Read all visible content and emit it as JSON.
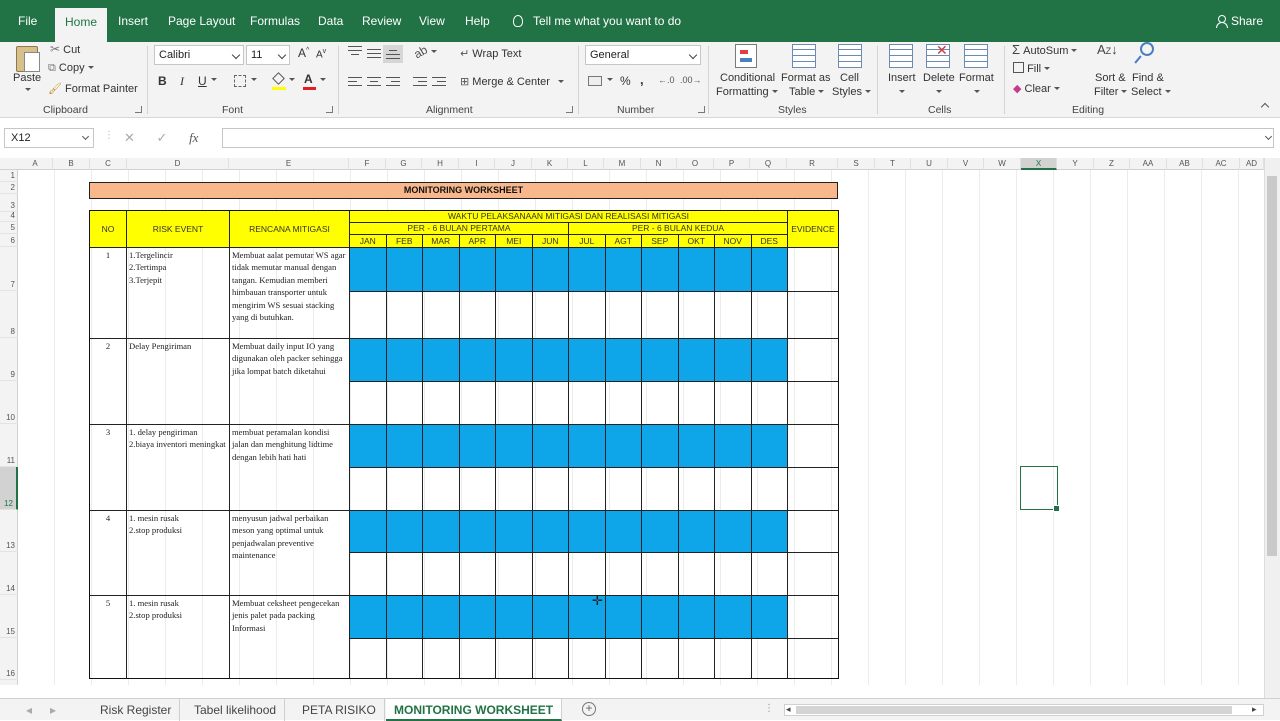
{
  "menu": {
    "tabs": [
      "File",
      "Home",
      "Insert",
      "Page Layout",
      "Formulas",
      "Data",
      "Review",
      "View",
      "Help"
    ],
    "active_tab": "Home",
    "tell_me": "Tell me what you want to do",
    "share": "Share"
  },
  "ribbon": {
    "clipboard": {
      "paste": "Paste",
      "cut": "Cut",
      "copy": "Copy",
      "format_painter": "Format Painter",
      "label": "Clipboard"
    },
    "font": {
      "family": "Calibri",
      "size": "11",
      "bold": "B",
      "italic": "I",
      "underline": "U",
      "label": "Font"
    },
    "alignment": {
      "wrap_text": "Wrap Text",
      "merge_center": "Merge & Center",
      "label": "Alignment"
    },
    "number": {
      "format": "General",
      "label": "Number"
    },
    "styles": {
      "conditional_1": "Conditional",
      "conditional_2": "Formatting",
      "format_table_1": "Format as",
      "format_table_2": "Table",
      "cell_styles_1": "Cell",
      "cell_styles_2": "Styles",
      "label": "Styles"
    },
    "cells": {
      "insert": "Insert",
      "delete": "Delete",
      "format": "Format",
      "label": "Cells"
    },
    "editing": {
      "autosum": "AutoSum",
      "fill": "Fill",
      "clear": "Clear",
      "sort_1": "Sort &",
      "sort_2": "Filter",
      "find_1": "Find &",
      "find_2": "Select",
      "label": "Editing"
    }
  },
  "formula_bar": {
    "name_box": "X12",
    "fx": "fx",
    "formula": ""
  },
  "columns": [
    "A",
    "B",
    "C",
    "D",
    "E",
    "F",
    "G",
    "H",
    "I",
    "J",
    "K",
    "L",
    "M",
    "N",
    "O",
    "P",
    "Q",
    "R",
    "S",
    "T",
    "U",
    "V",
    "W",
    "X",
    "Y",
    "Z",
    "AA",
    "AB",
    "AC",
    "AD"
  ],
  "selected_column": "X",
  "rows": [
    "1",
    "2",
    "3",
    "4",
    "5",
    "6",
    "7",
    "8",
    "9",
    "10",
    "11",
    "12",
    "13",
    "14",
    "15",
    "16"
  ],
  "selected_row": "12",
  "worksheet": {
    "title": "MONITORING WORKSHEET",
    "header_no": "NO",
    "header_risk": "RISK EVENT",
    "header_plan": "RENCANA MITIGASI",
    "header_time": "WAKTU PELAKSANAAN MITIGASI DAN REALISASI MITIGASI",
    "header_half1": "PER - 6 BULAN PERTAMA",
    "header_half2": "PER - 6 BULAN KEDUA",
    "header_evidence": "EVIDENCE",
    "months": [
      "JAN",
      "FEB",
      "MAR",
      "APR",
      "MEI",
      "JUN",
      "JUL",
      "AGT",
      "SEP",
      "OKT",
      "NOV",
      "DES"
    ],
    "items": [
      {
        "no": "1",
        "risk": "1.Tergelincir\n2.Tertimpa\n3.Terjepit",
        "plan": "Membuat aalat pemutar WS agar tidak memutar manual dengan tangan. Kemudian memberi himbauan transporter untuk mengirim WS sesuai stacking yang di butuhkan."
      },
      {
        "no": "2",
        "risk": "Delay Pengiriman",
        "plan": "Membuat daily input IO yang digunakan oleh packer sehingga jika lompat batch diketahui"
      },
      {
        "no": "3",
        "risk": "1. delay pengiriman\n2.biaya inventori meningkat",
        "plan": "membuat peramalan kondisi jalan dan menghitung lidtime dengan lebih hati hati"
      },
      {
        "no": "4",
        "risk": "1. mesin rusak\n2.stop produksi",
        "plan": "menyusun jadwal perbaikan meson yang optimal untuk penjadwalan preventive maintenance"
      },
      {
        "no": "5",
        "risk": "1. mesin rusak\n2.stop produksi",
        "plan": "Membuat ceksheet pengecekan jenis palet pada packing Informasi"
      }
    ]
  },
  "sheet_tabs": [
    "Risk Register",
    "Tabel likelihood",
    "PETA RISIKO",
    "MONITORING WORKSHEET"
  ],
  "active_sheet": "MONITORING WORKSHEET",
  "colors": {
    "excel_green": "#217346",
    "header_yellow": "#ffff00",
    "title_orange": "#f8b88b",
    "plan_blue": "#0ea5e9"
  }
}
